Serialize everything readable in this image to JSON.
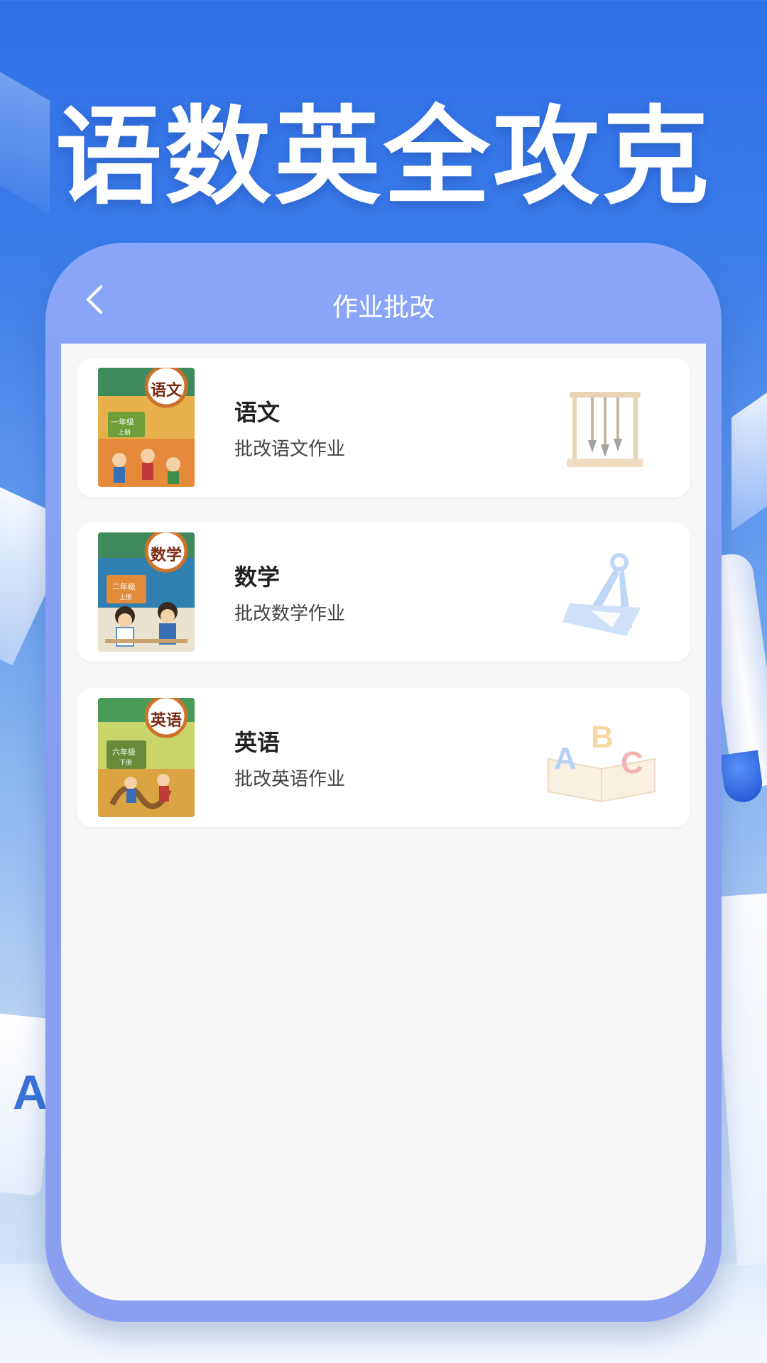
{
  "headline": "语数英全攻克",
  "navbar": {
    "title": "作业批改"
  },
  "subjects": [
    {
      "title": "语文",
      "subtitle": "批改语文作业",
      "cover_label": "语文",
      "cover_grade": "一年级",
      "cover_volume": "上册"
    },
    {
      "title": "数学",
      "subtitle": "批改数学作业",
      "cover_label": "数学",
      "cover_grade": "二年级",
      "cover_volume": "上册"
    },
    {
      "title": "英语",
      "subtitle": "批改英语作业",
      "cover_label": "英语",
      "cover_grade": "六年级",
      "cover_volume": "下册"
    }
  ],
  "deco_letters": {
    "card_letter": "A"
  },
  "colors": {
    "bg_top": "#2f6fe6",
    "phone_frame": "#859ef2",
    "screen_bg": "#f7f7f9"
  }
}
